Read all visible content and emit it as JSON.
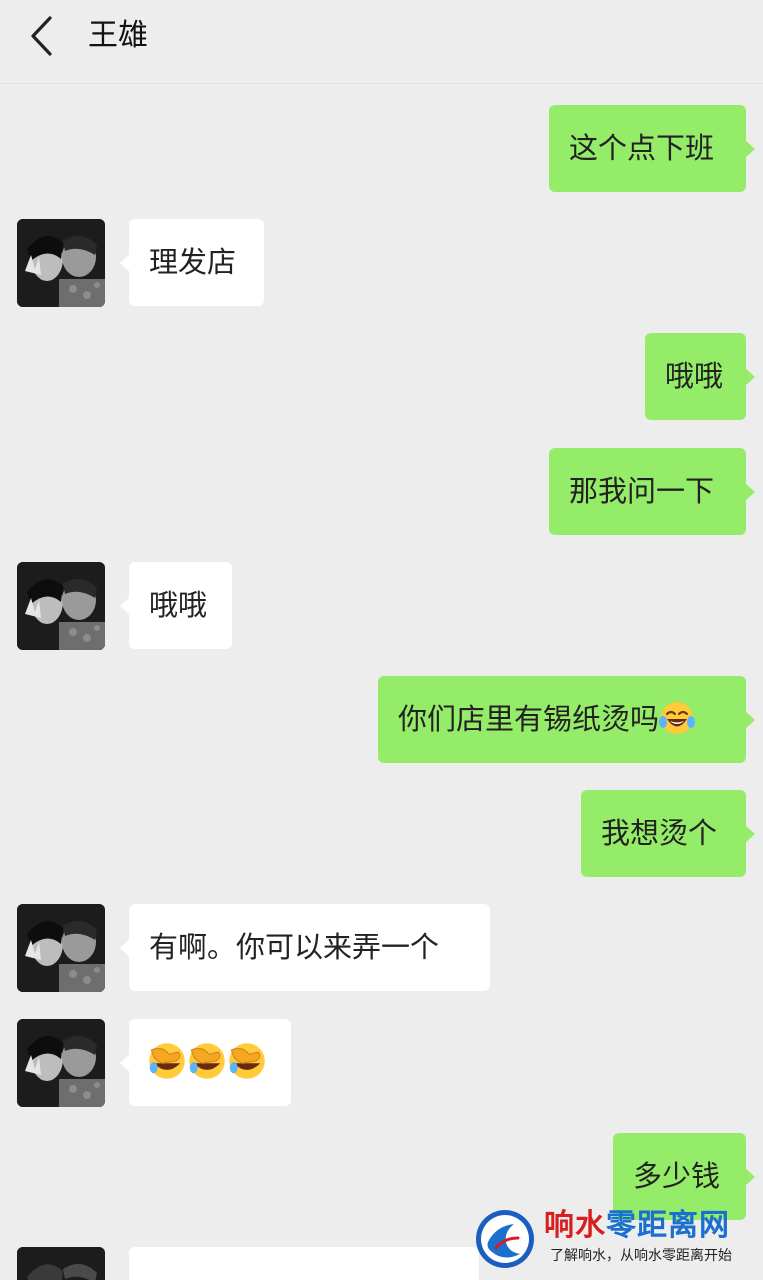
{
  "header": {
    "title": "王雄",
    "back_icon": "chevron-left-icon"
  },
  "messages": [
    {
      "side": "out",
      "text": "这个点下班"
    },
    {
      "side": "in",
      "text": "理发店"
    },
    {
      "side": "out",
      "text": "哦哦"
    },
    {
      "side": "out",
      "text": "那我问一下"
    },
    {
      "side": "in",
      "text": "哦哦"
    },
    {
      "side": "out",
      "text": "你们店里有锡纸烫吗",
      "emoji": "tears-of-joy-emoji"
    },
    {
      "side": "out",
      "text": "我想烫个"
    },
    {
      "side": "in",
      "text": "有啊。你可以来弄一个"
    },
    {
      "side": "in",
      "text": "",
      "emoji": [
        "facepalm-emoji",
        "facepalm-emoji",
        "facepalm-emoji"
      ]
    },
    {
      "side": "out",
      "text": "多少钱"
    }
  ],
  "watermark": {
    "name_part1": "响水",
    "name_part2": "零距离网",
    "tagline": "了解响水，从响水零距离开始"
  },
  "colors": {
    "background": "#ededed",
    "outgoing_bubble": "#95ec69",
    "incoming_bubble": "#ffffff",
    "watermark_red": "#d81e1e",
    "watermark_blue": "#1a6fd0"
  }
}
